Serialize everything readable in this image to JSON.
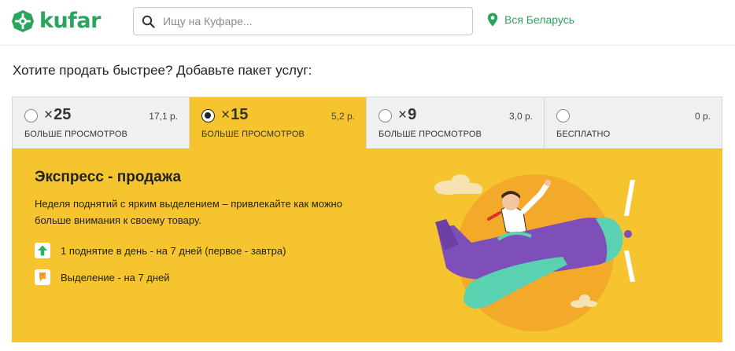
{
  "header": {
    "logo_text": "kufar",
    "search_placeholder": "Ищу на Куфаре...",
    "location": "Вся Беларусь"
  },
  "title": "Хотите продать быстрее? Добавьте пакет услуг:",
  "tabs": [
    {
      "multiplier": "25",
      "price": "17,1 р.",
      "subtitle": "БОЛЬШЕ ПРОСМОТРОВ",
      "selected": false
    },
    {
      "multiplier": "15",
      "price": "5,2 р.",
      "subtitle": "БОЛЬШЕ ПРОСМОТРОВ",
      "selected": true
    },
    {
      "multiplier": "9",
      "price": "3,0 р.",
      "subtitle": "БОЛЬШЕ ПРОСМОТРОВ",
      "selected": false
    },
    {
      "multiplier": "",
      "price": "0 р.",
      "subtitle": "БЕСПЛАТНО",
      "selected": false
    }
  ],
  "multiplier_sign": "×",
  "panel": {
    "title": "Экспресс - продажа",
    "description": "Неделя поднятий с ярким выделением – привлекайте как можно больше внимания к своему товару.",
    "features": [
      {
        "icon": "arrow-up-icon",
        "text": "1 поднятие в день - на 7 дней (первое - завтра)"
      },
      {
        "icon": "highlight-icon",
        "text": "Выделение - на 7 дней"
      }
    ]
  },
  "colors": {
    "brand_green": "#2ba55e",
    "accent_yellow": "#f6c42e",
    "tab_inactive": "#f0f0f0"
  }
}
